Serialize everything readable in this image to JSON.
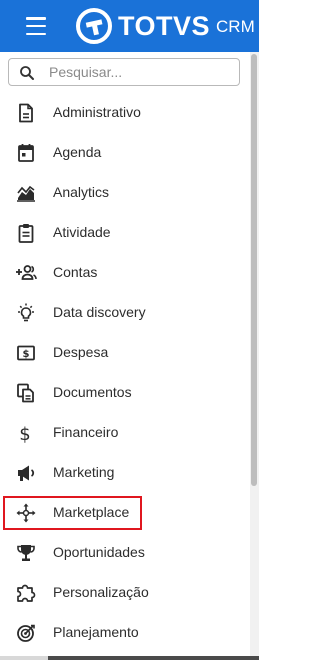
{
  "colors": {
    "header_bg": "#1a72d8",
    "highlight_border": "#e0171f",
    "icon": "#2b2b2b"
  },
  "header": {
    "brand": "TOTVS",
    "product": "CRM"
  },
  "search": {
    "placeholder": "Pesquisar..."
  },
  "sidebar": {
    "items": [
      {
        "label": "Administrativo",
        "icon": "document-icon"
      },
      {
        "label": "Agenda",
        "icon": "calendar-icon"
      },
      {
        "label": "Analytics",
        "icon": "area-chart-icon"
      },
      {
        "label": "Atividade",
        "icon": "clipboard-icon"
      },
      {
        "label": "Contas",
        "icon": "add-user-icon"
      },
      {
        "label": "Data discovery",
        "icon": "lightbulb-icon"
      },
      {
        "label": "Despesa",
        "icon": "money-icon"
      },
      {
        "label": "Documentos",
        "icon": "copy-documents-icon"
      },
      {
        "label": "Financeiro",
        "icon": "dollar-icon"
      },
      {
        "label": "Marketing",
        "icon": "megaphone-icon"
      },
      {
        "label": "Marketplace",
        "icon": "move-arrows-icon",
        "highlighted": true
      },
      {
        "label": "Oportunidades",
        "icon": "trophy-icon"
      },
      {
        "label": "Personalização",
        "icon": "puzzle-icon"
      },
      {
        "label": "Planejamento",
        "icon": "target-icon"
      }
    ]
  }
}
